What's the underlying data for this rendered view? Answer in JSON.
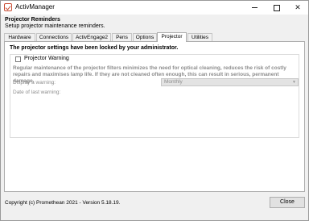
{
  "window": {
    "title": "ActivManager"
  },
  "header": {
    "title": "Projector Reminders",
    "subtitle": "Setup projector maintenance reminders."
  },
  "tabs": [
    {
      "label": "Hardware"
    },
    {
      "label": "Connections"
    },
    {
      "label": "ActivEngage2"
    },
    {
      "label": "Pens"
    },
    {
      "label": "Options"
    },
    {
      "label": "Projector",
      "active": true
    },
    {
      "label": "Utilities"
    }
  ],
  "panel": {
    "locked_notice": "The projector settings have been locked by your administrator.",
    "warning_checkbox_label": "Projector Warning",
    "warning_checked": false,
    "description": "Regular maintenance of the projector filters minimizes the need for optical cleaning, reduces the risk of costly repairs and maximises lamp life. If they are not cleaned often enough, this can result in serious, permanent damage.",
    "display_label": "Display a warning:",
    "display_value": "Monthly",
    "date_label": "Date of last warning:"
  },
  "footer": {
    "copyright": "Copyright (c) Promethean 2021 - Version 5.18.19.",
    "close_label": "Close"
  },
  "icons": {
    "app": "activmanager-check-icon",
    "minimize": "minimize-icon",
    "maximize": "maximize-icon",
    "close": "close-icon",
    "dropdown": "chevron-down-icon"
  }
}
